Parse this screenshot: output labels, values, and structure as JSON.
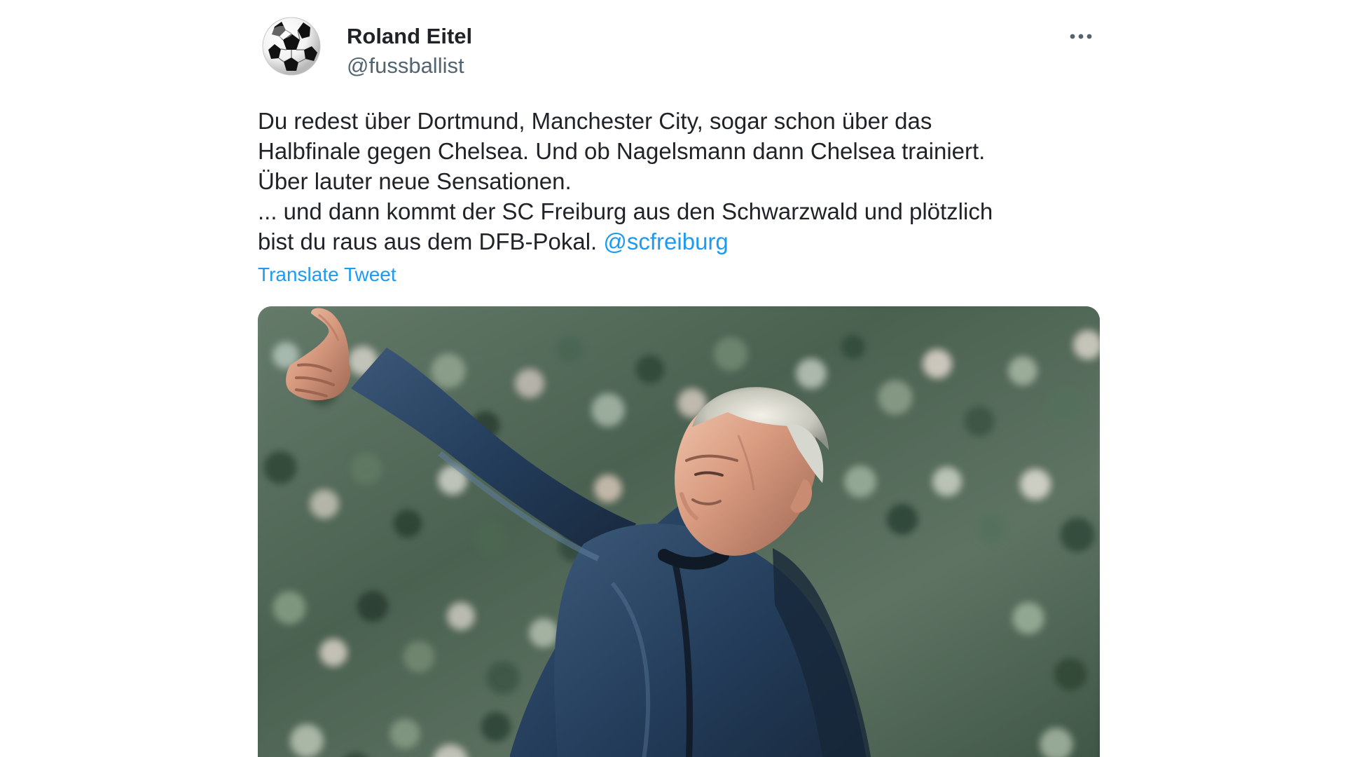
{
  "tweet": {
    "author": {
      "display_name": "Roland Eitel",
      "handle": "@fussballist",
      "avatar_icon": "soccer-ball-icon"
    },
    "more_icon": "more-horizontal-icon",
    "text": {
      "body": "Du redest über Dortmund, Manchester City, sogar schon über das\nHalbfinale gegen Chelsea. Und ob Nagelsmann dann Chelsea trainiert.\nÜber lauter neue Sensationen.\n... und dann kommt der SC Freiburg aus den Schwarzwald und plötzlich\nbist du raus aus dem DFB-Pokal. ",
      "mention": "@scfreiburg"
    },
    "translate_label": "Translate Tweet",
    "media": {
      "type": "photo"
    }
  },
  "colors": {
    "link": "#1d9bf0",
    "text": "#0f1419",
    "secondary_text": "#536471",
    "jacket": "#1f3147"
  }
}
